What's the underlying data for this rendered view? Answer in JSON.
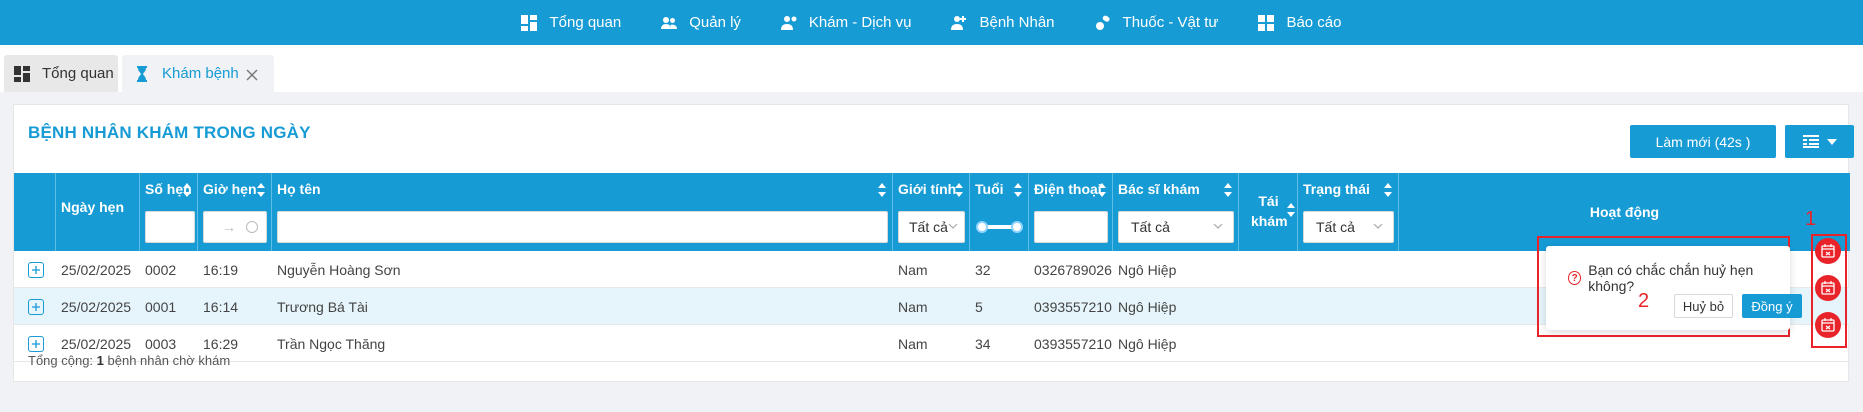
{
  "nav": {
    "items": [
      {
        "label": "Tổng quan",
        "icon": "dashboard-icon"
      },
      {
        "label": "Quản lý",
        "icon": "users-icon"
      },
      {
        "label": "Khám - Dịch vụ",
        "icon": "doctor-service-icon"
      },
      {
        "label": "Bệnh Nhân",
        "icon": "patient-icon"
      },
      {
        "label": "Thuốc - Vật tư",
        "icon": "medicine-icon"
      },
      {
        "label": "Báo cáo",
        "icon": "report-icon"
      }
    ]
  },
  "tabs": [
    {
      "label": "Tổng quan",
      "icon": "dashboard-icon"
    },
    {
      "label": "Khám bệnh",
      "icon": "hourglass-icon",
      "active": true
    }
  ],
  "panel": {
    "title": "BỆNH NHÂN KHÁM TRONG NGÀY",
    "refresh_label": "Làm mới (42s )"
  },
  "table": {
    "columns": {
      "date": "Ngày hẹn",
      "number": "Số hẹn",
      "time": "Giờ hẹn",
      "name": "Họ tên",
      "gender": "Giới tính",
      "age": "Tuổi",
      "phone": "Điện thoại",
      "doctor": "Bác sĩ khám",
      "revisit": "Tái khám",
      "status": "Trạng thái",
      "actions": "Hoạt động"
    },
    "filters": {
      "gender": "Tất cả",
      "doctor": "Tất cả",
      "status": "Tất cả",
      "time_arrow": "→"
    },
    "rows": [
      {
        "date": "25/02/2025",
        "number": "0002",
        "time": "16:19",
        "name": "Nguyễn Hoàng Sơn",
        "gender": "Nam",
        "age": "32",
        "phone": "0326789026",
        "doctor": "Ngô Hiệp"
      },
      {
        "date": "25/02/2025",
        "number": "0001",
        "time": "16:14",
        "name": "Trương Bá Tài",
        "gender": "Nam",
        "age": "5",
        "phone": "0393557210",
        "doctor": "Ngô Hiệp"
      },
      {
        "date": "25/02/2025",
        "number": "0003",
        "time": "16:29",
        "name": "Trần Ngọc Thăng",
        "gender": "Nam",
        "age": "34",
        "phone": "0393557210",
        "doctor": "Ngô Hiệp"
      }
    ]
  },
  "footer": {
    "prefix": "Tổng cộng: ",
    "count": "1",
    "suffix": " bệnh nhân chờ khám"
  },
  "popconfirm": {
    "message": "Bạn có chắc chắn huỷ hẹn không?",
    "cancel_label": "Huỷ bỏ",
    "ok_label": "Đồng ý"
  },
  "annotations": {
    "marker_1": "1",
    "marker_2": "2"
  },
  "colors": {
    "primary": "#169bd5",
    "danger": "#e8242a",
    "row_alt": "#e6f5fb"
  }
}
